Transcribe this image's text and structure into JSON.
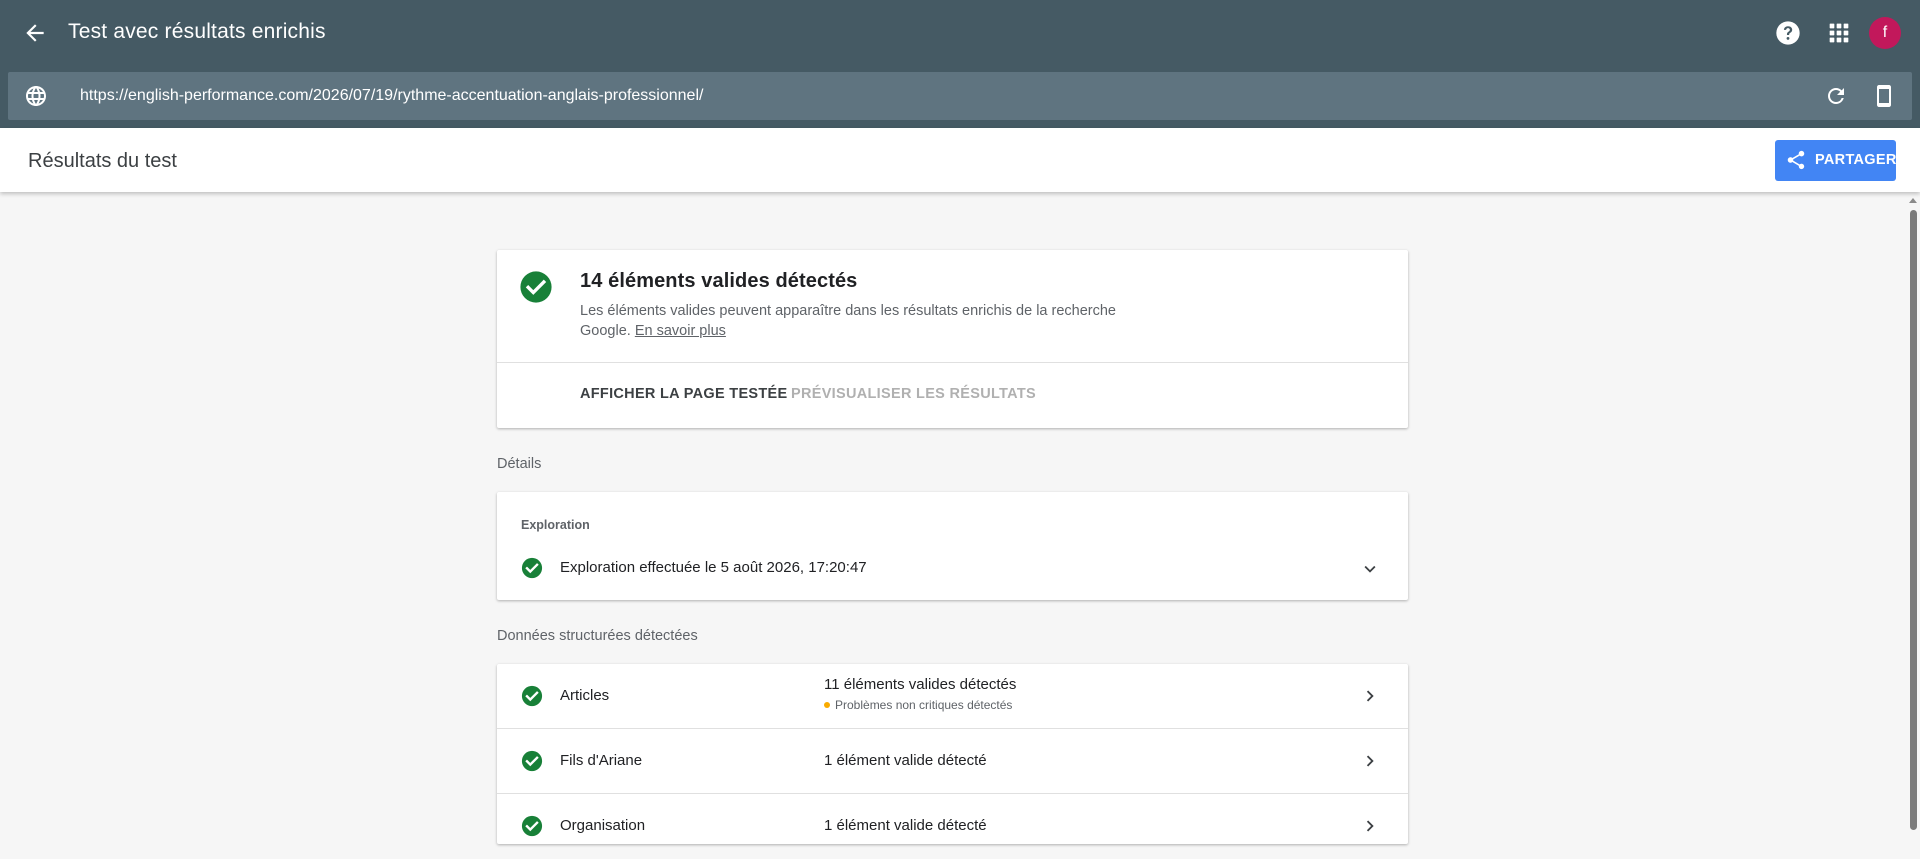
{
  "app": {
    "title": "Test avec résultats enrichis",
    "url": "https://english-performance.com/2026/07/19/rythme-accentuation-anglais-professionnel/",
    "avatar_letter": "f"
  },
  "results_header": {
    "title": "Résultats du test",
    "share_label": "PARTAGER"
  },
  "summary": {
    "title": "14 éléments valides détectés",
    "description": "Les éléments valides peuvent apparaître dans les résultats enrichis de la recherche Google.",
    "learn_more": "En savoir plus",
    "view_tested_page": "AFFICHER LA PAGE TESTÉE",
    "preview_results": "PRÉVISUALISER LES RÉSULTATS"
  },
  "details": {
    "section_label": "Détails",
    "exploration_heading": "Exploration",
    "exploration_text": "Exploration effectuée le 5 août 2026, 17:20:47"
  },
  "structured_data": {
    "section_label": "Données structurées détectées",
    "rows": [
      {
        "name": "Articles",
        "status": "11 éléments valides détectés",
        "warning": "Problèmes non critiques détectés"
      },
      {
        "name": "Fils d'Ariane",
        "status": "1 élément valide détecté"
      },
      {
        "name": "Organisation",
        "status": "1 élément valide détecté"
      }
    ]
  },
  "colors": {
    "appbar": "#455a64",
    "url_bar": "#5f7480",
    "accent_blue": "#4285f4",
    "success_green": "#188038",
    "warning_orange": "#f9ab00",
    "avatar": "#c2185b"
  }
}
